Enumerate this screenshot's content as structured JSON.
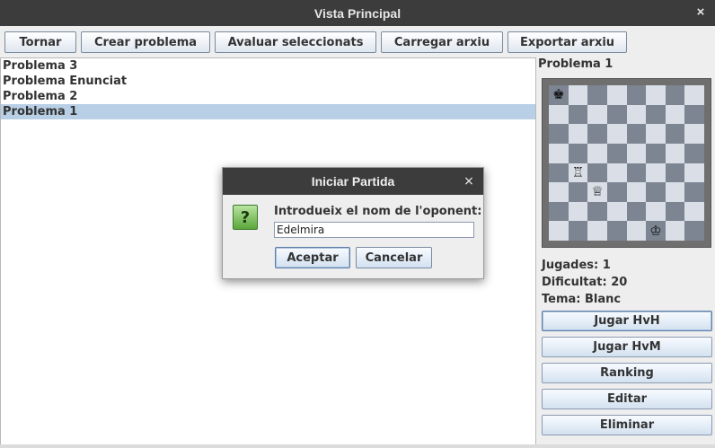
{
  "window": {
    "title": "Vista Principal",
    "close_glyph": "×"
  },
  "toolbar": {
    "buttons": [
      {
        "label": "Tornar"
      },
      {
        "label": "Crear problema"
      },
      {
        "label": "Avaluar seleccionats"
      },
      {
        "label": "Carregar arxiu"
      },
      {
        "label": "Exportar arxiu"
      }
    ]
  },
  "problems": {
    "items": [
      {
        "label": "Problema 3"
      },
      {
        "label": "Problema Enunciat"
      },
      {
        "label": "Problema 2"
      },
      {
        "label": "Problema 1"
      }
    ],
    "selected_index": 3
  },
  "detail": {
    "title": "Problema 1",
    "jugades": "Jugades: 1",
    "dificultat": "Dificultat: 20",
    "tema": "Tema: Blanc",
    "buttons": [
      {
        "label": "Jugar HvH"
      },
      {
        "label": "Jugar HvM"
      },
      {
        "label": "Ranking"
      },
      {
        "label": "Editar"
      },
      {
        "label": "Eliminar"
      }
    ]
  },
  "board": {
    "pieces": [
      {
        "square": "a8",
        "piece": "black-king",
        "glyph": "♚"
      },
      {
        "square": "b4",
        "piece": "white-rook",
        "glyph": "♖"
      },
      {
        "square": "c3",
        "piece": "white-queen",
        "glyph": "♕"
      },
      {
        "square": "f1",
        "piece": "white-king",
        "glyph": "♔"
      }
    ],
    "colors": {
      "light": "#dadfe7",
      "dark": "#7d8593"
    }
  },
  "dialog": {
    "title": "Iniciar Partida",
    "close_glyph": "×",
    "icon": "question-icon",
    "icon_glyph": "?",
    "prompt": "Introdueix el nom de l'oponent:",
    "input_value": "Edelmira",
    "accept_label": "Aceptar",
    "cancel_label": "Cancelar"
  }
}
